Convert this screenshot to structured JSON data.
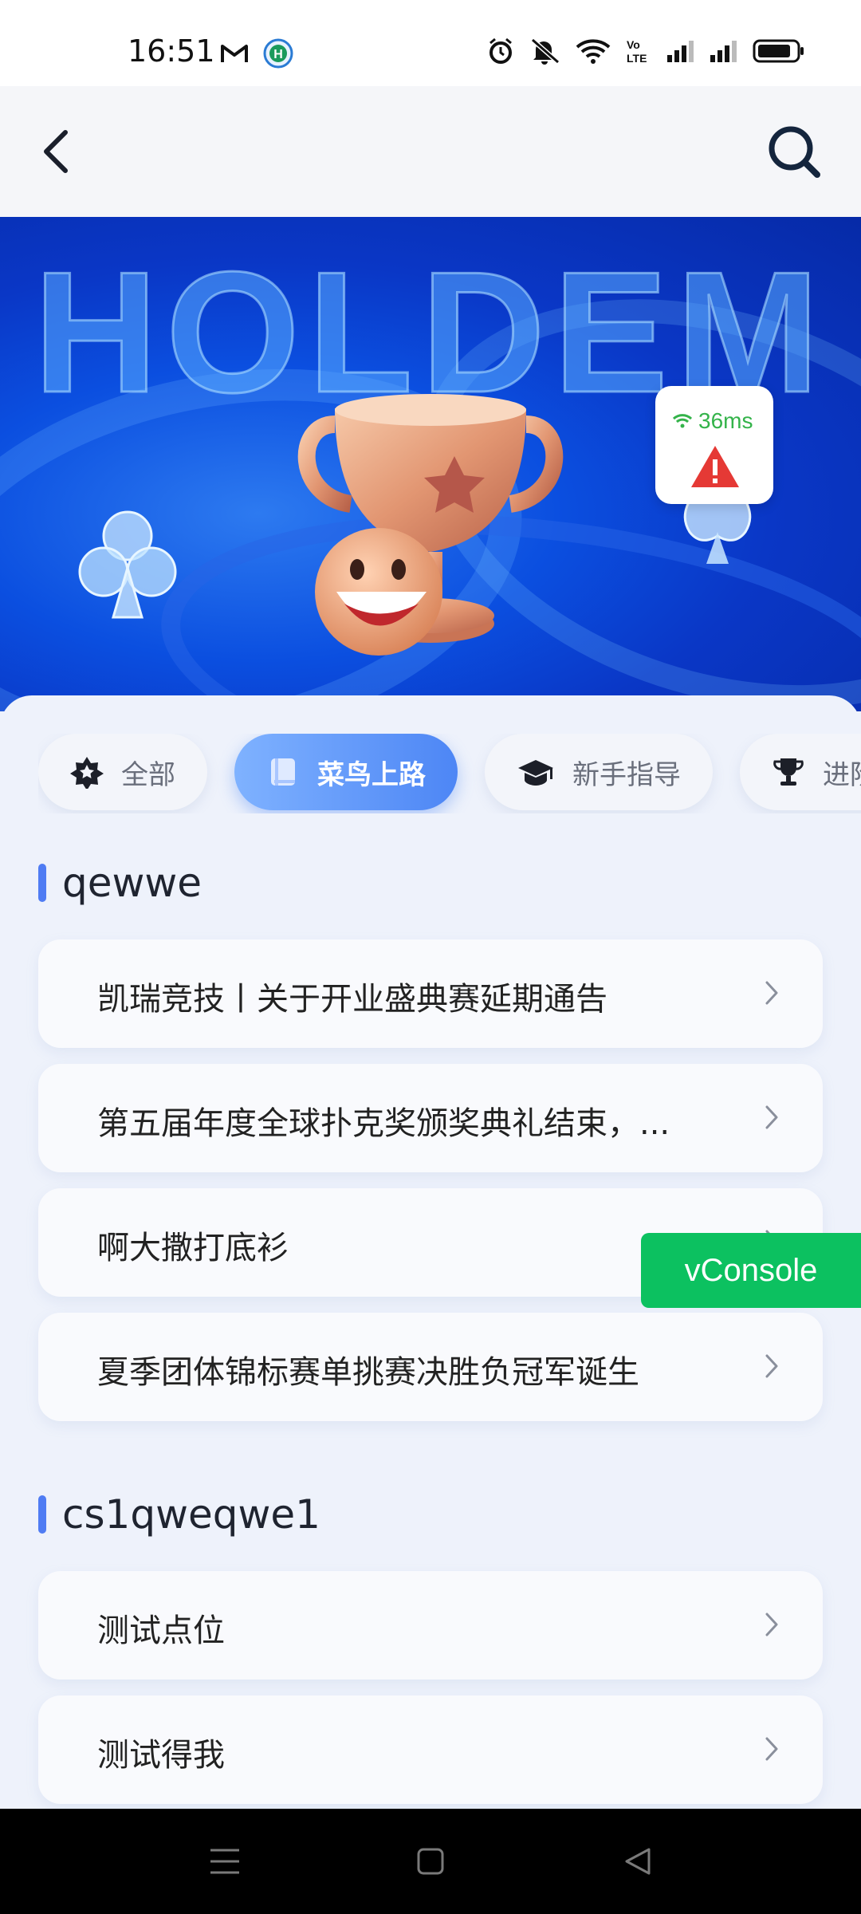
{
  "status_bar": {
    "time": "16:51",
    "left_icons": [
      "gmail-icon",
      "app-h-icon"
    ],
    "right_icons": [
      "alarm-icon",
      "mute-icon",
      "wifi-icon",
      "volte-icon",
      "signal-icon",
      "signal-icon",
      "battery-icon"
    ]
  },
  "header": {
    "back_icon": "chevron-left-icon",
    "search_icon": "search-icon"
  },
  "banner": {
    "title": "HOLDEM",
    "latency": "36ms",
    "latency_color": "#34b34a",
    "warning_color": "#e53935"
  },
  "tabs": [
    {
      "label": "全部",
      "icon": "star-badge-icon",
      "active": false
    },
    {
      "label": "菜鸟上路",
      "icon": "book-icon",
      "active": true
    },
    {
      "label": "新手指导",
      "icon": "graduation-cap-icon",
      "active": false
    },
    {
      "label": "进阶",
      "icon": "trophy-icon",
      "active": false
    }
  ],
  "sections": [
    {
      "title": "qewwe",
      "items": [
        "凯瑞竞技丨关于开业盛典赛延期通告",
        "第五届年度全球扑克奖颁奖典礼结束，...",
        "啊大撒打底衫",
        "夏季团体锦标赛单挑赛决胜负冠军诞生"
      ]
    },
    {
      "title": "cs1qweqwe1",
      "items": [
        "测试点位",
        "测试得我"
      ]
    }
  ],
  "vconsole": {
    "label": "vConsole",
    "color": "#0cc160"
  },
  "accent_color": "#4f7cf3"
}
